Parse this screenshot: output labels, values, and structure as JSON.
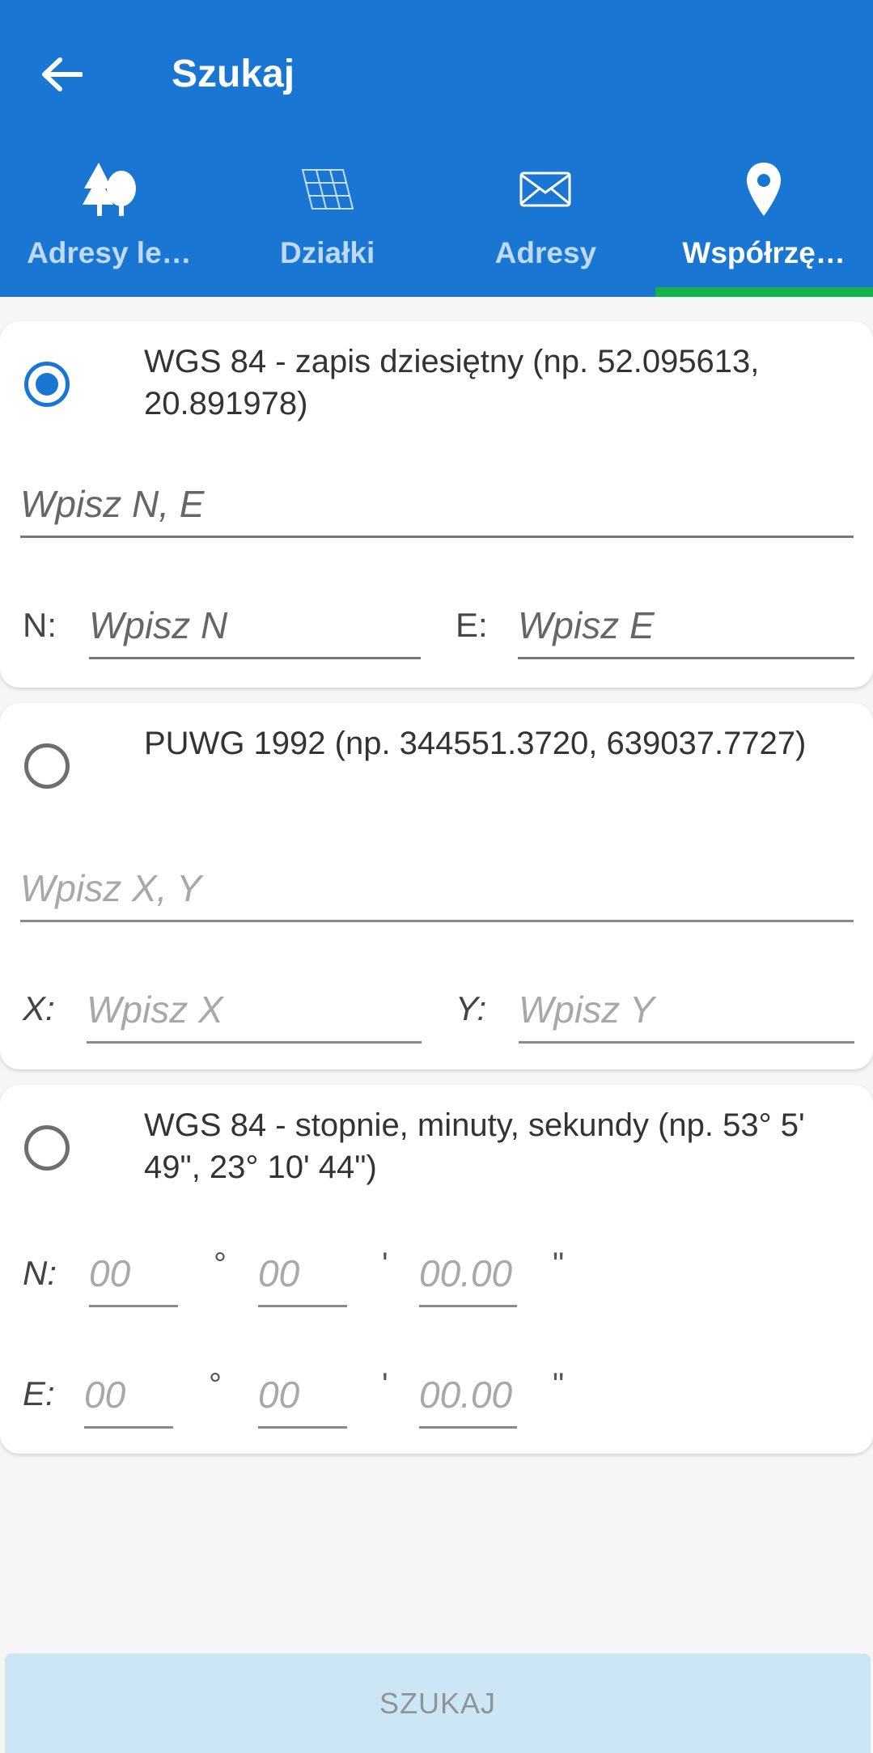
{
  "header": {
    "title": "Szukaj"
  },
  "tabs": [
    {
      "label": "Adresy le…",
      "icon": "forest-trees-icon",
      "active": false
    },
    {
      "label": "Działki",
      "icon": "parcel-grid-icon",
      "active": false
    },
    {
      "label": "Adresy",
      "icon": "envelope-icon",
      "active": false
    },
    {
      "label": "Współrzę…",
      "icon": "location-pin-icon",
      "active": true
    }
  ],
  "colors": {
    "primary": "#1976d2",
    "tab_indicator": "#12b34a",
    "button_disabled_bg": "#cde6f5"
  },
  "option_wgs84_decimal": {
    "selected": true,
    "label": "WGS 84 - zapis dziesiętny (np. 52.095613, 20.891978)",
    "combined_placeholder": "Wpisz N, E",
    "n_label": "N:",
    "n_placeholder": "Wpisz N",
    "e_label": "E:",
    "e_placeholder": "Wpisz E"
  },
  "option_puwg1992": {
    "selected": false,
    "label": "PUWG 1992 (np. 344551.3720, 639037.7727)",
    "combined_placeholder": "Wpisz X, Y",
    "x_label": "X:",
    "x_placeholder": "Wpisz X",
    "y_label": "Y:",
    "y_placeholder": "Wpisz Y"
  },
  "option_wgs84_dms": {
    "selected": false,
    "label": "WGS 84 - stopnie, minuty, sekundy (np. 53° 5' 49\", 23° 10' 44\")",
    "n_label": "N:",
    "e_label": "E:",
    "deg_placeholder": "00",
    "min_placeholder": "00",
    "sec_placeholder": "00.00",
    "deg_symbol": "°",
    "min_symbol": "'",
    "sec_symbol": "\""
  },
  "search_button": {
    "label": "SZUKAJ"
  }
}
